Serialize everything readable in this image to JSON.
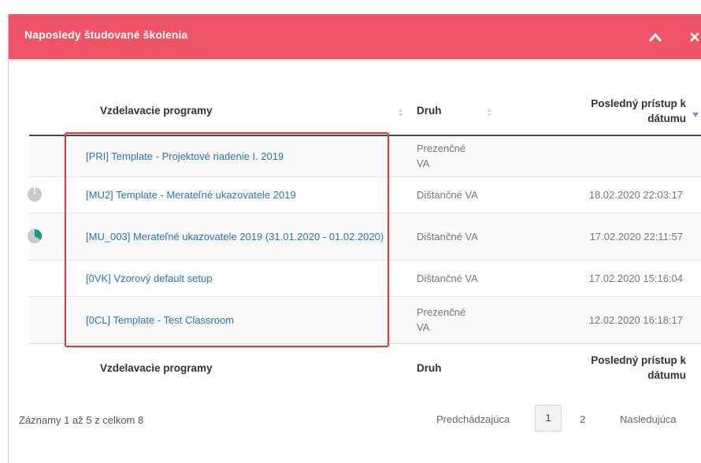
{
  "panel": {
    "title": "Naposledy študované školenia",
    "icons": {
      "collapse": "chevron-up-icon",
      "close": "close-icon"
    },
    "accent_color": "#ee5466"
  },
  "table": {
    "headers": {
      "program": "Vzdelavacie programy",
      "type": "Druh",
      "date_line1": "Posledný prístup k",
      "date_line2": "dátumu"
    },
    "rows": [
      {
        "progress_icon": "empty",
        "name": "[PRI] Template - Projektové riadenie I. 2019",
        "type": "Prezenčné VA",
        "date": ""
      },
      {
        "progress_icon": "pie-empty-grey",
        "name": "[MU2] Template - Merateľné ukazovatele 2019",
        "type": "Dištančné VA",
        "date": "18.02.2020 22:03:17"
      },
      {
        "progress_icon": "pie-partial-green",
        "name": "[MU_003] Merateľné ukazovatele 2019 (31.01.2020 - 01.02.2020)",
        "type": "Dištančné VA",
        "date": "17.02.2020 22:11:57"
      },
      {
        "progress_icon": "none",
        "name": "[0VK] Vzorový default setup",
        "type": "Dištančné VA",
        "date": "17.02.2020 15:16:04"
      },
      {
        "progress_icon": "empty",
        "name": "[0CL] Template - Test Classroom",
        "type": "Prezenčné VA",
        "date": "12.02.2020 16:18:17"
      }
    ]
  },
  "info": "Záznamy 1 až 5 z celkom 8",
  "pagination": {
    "prev": "Predchádzajúca",
    "current": "1",
    "page2": "2",
    "next": "Nasledujúca"
  },
  "colors": {
    "link": "#2a73c1",
    "highlight": "#e0393a",
    "progress_green": "#1a9a84"
  }
}
